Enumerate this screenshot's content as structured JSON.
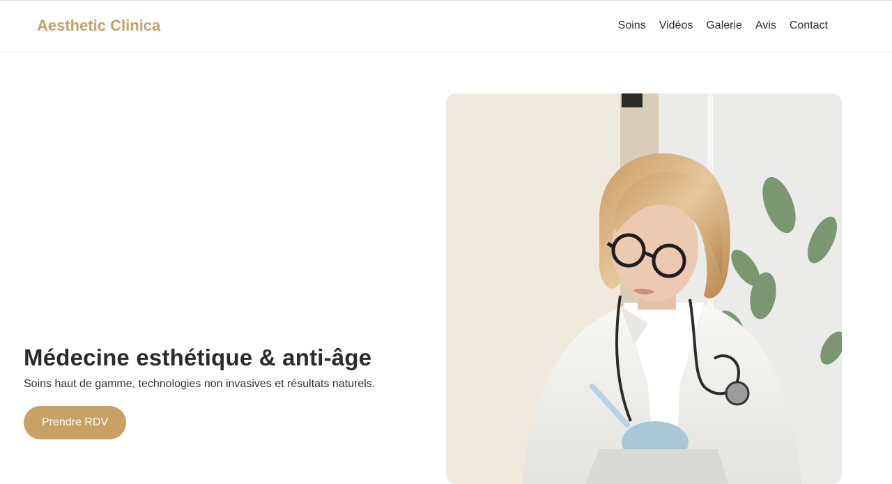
{
  "brand": {
    "name": "Aesthetic Clinica",
    "color": "#c59f64"
  },
  "nav": {
    "items": [
      {
        "label": "Soins"
      },
      {
        "label": "Vidéos"
      },
      {
        "label": "Galerie"
      },
      {
        "label": "Avis"
      },
      {
        "label": "Contact"
      }
    ]
  },
  "hero": {
    "title": "Médecine esthétique & anti-âge",
    "subtitle": "Soins haut de gamme, technologies non invasives et résultats naturels.",
    "cta_label": "Prendre RDV",
    "cta_color": "#c8a165",
    "image_subject": "doctor-photo"
  }
}
